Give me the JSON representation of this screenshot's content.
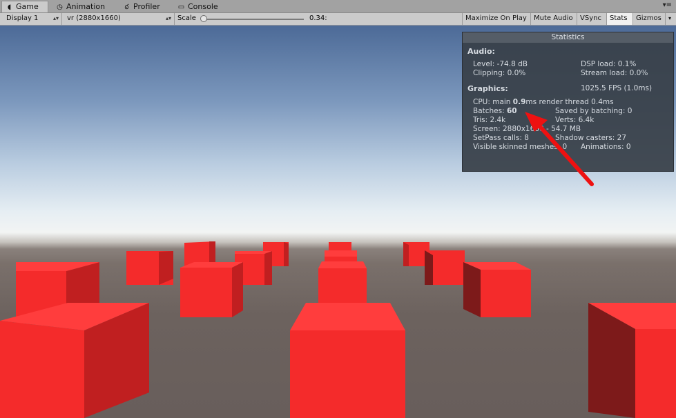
{
  "tabs": [
    {
      "label": "Game",
      "icon": "pacman-icon"
    },
    {
      "label": "Animation",
      "icon": "clock-icon"
    },
    {
      "label": "Profiler",
      "icon": "profiler-icon"
    },
    {
      "label": "Console",
      "icon": "console-icon"
    }
  ],
  "tab_menu_icon": "window-menu-icon",
  "toolbar": {
    "display": "Display 1",
    "resolution": "vr (2880x1660)",
    "scale_label": "Scale",
    "scale_value": "0.34:",
    "buttons": [
      "Maximize On Play",
      "Mute Audio",
      "VSync",
      "Stats",
      "Gizmos"
    ],
    "active_button": "Stats"
  },
  "stats": {
    "title": "Statistics",
    "audio_header": "Audio:",
    "level": "Level: -74.8 dB",
    "dsp": "DSP load: 0.1%",
    "clipping": "Clipping: 0.0%",
    "stream": "Stream load: 0.0%",
    "graphics_header": "Graphics:",
    "fps": "1025.5 FPS (1.0ms)",
    "cpu_prefix": "CPU: main ",
    "cpu_main": "0.9",
    "cpu_suffix": "ms  render thread 0.4ms",
    "batches_prefix": "Batches: ",
    "batches": "60",
    "saved_batching": "Saved by batching: 0",
    "tris": "Tris: 2.4k",
    "verts": "Verts: 6.4k",
    "screen": "Screen: 2880x1660 - 54.7 MB",
    "setpass": "SetPass calls: 8",
    "shadow": "Shadow casters: 27",
    "skinned": "Visible skinned meshes: 0",
    "animations": "Animations: 0"
  },
  "colors": {
    "cube_front": "#f42b2b",
    "cube_top": "#ff3d3d",
    "cube_side": "#c01f20",
    "cube_dark_side": "#7d1a1a",
    "annotation_arrow": "#ee1111"
  }
}
